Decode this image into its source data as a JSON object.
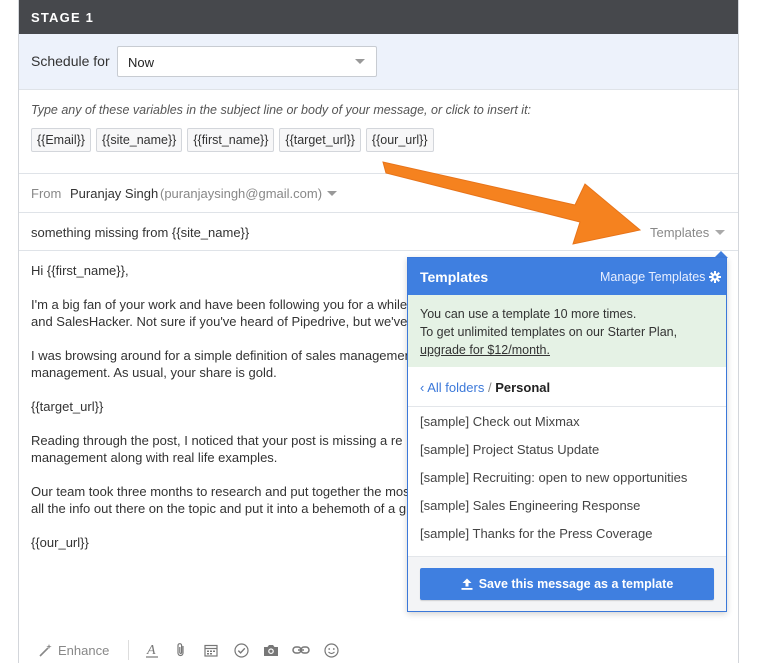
{
  "stage": {
    "title": "STAGE 1"
  },
  "schedule": {
    "label": "Schedule for",
    "value": "Now"
  },
  "variables": {
    "hint": "Type any of these variables in the subject line or body of your message, or click to insert it:",
    "chips": [
      "{{Email}}",
      "{{site_name}}",
      "{{first_name}}",
      "{{target_url}}",
      "{{our_url}}"
    ]
  },
  "from": {
    "label": "From",
    "name": "Puranjay Singh",
    "email": "(puranjaysingh@gmail.com)"
  },
  "subject": {
    "text": "something missing from {{site_name}}",
    "templates_label": "Templates"
  },
  "body": {
    "lines": [
      "Hi {{first_name}},",
      "I'm a big fan of your work and have been following you for a while",
      "and SalesHacker. Not sure if you've heard of Pipedrive, but we've",
      "I was browsing around for a simple definition of sales managemen",
      "management. As usual, your share is gold.",
      "{{target_url}}",
      "Reading through the post, I noticed that your post is missing a re",
      "management along with real life examples.",
      "Our team took three months to research and put together the mos",
      "all the info out there on the topic and put it into a behemoth of a g",
      "{{our_url}}"
    ]
  },
  "toolbar": {
    "enhance_label": "Enhance"
  },
  "templates_popup": {
    "title": "Templates",
    "manage_label": "Manage Templates",
    "notice_line1": "You can use a template 10 more times.",
    "notice_line2": "To get unlimited templates on our Starter Plan,",
    "notice_link": "upgrade for $12/month.",
    "crumb_all": "All folders",
    "crumb_sep": "/",
    "crumb_current": "Personal",
    "items": [
      "[sample] Check out Mixmax",
      "[sample] Project Status Update",
      "[sample] Recruiting: open to new opportunities",
      "[sample] Sales Engineering Response",
      "[sample] Thanks for the Press Coverage"
    ],
    "save_label": "Save this message as a template"
  },
  "colors": {
    "accent": "#3f7fe0",
    "header": "#46484c",
    "notice_bg": "#e5f2e5",
    "arrow": "#f5821f"
  }
}
